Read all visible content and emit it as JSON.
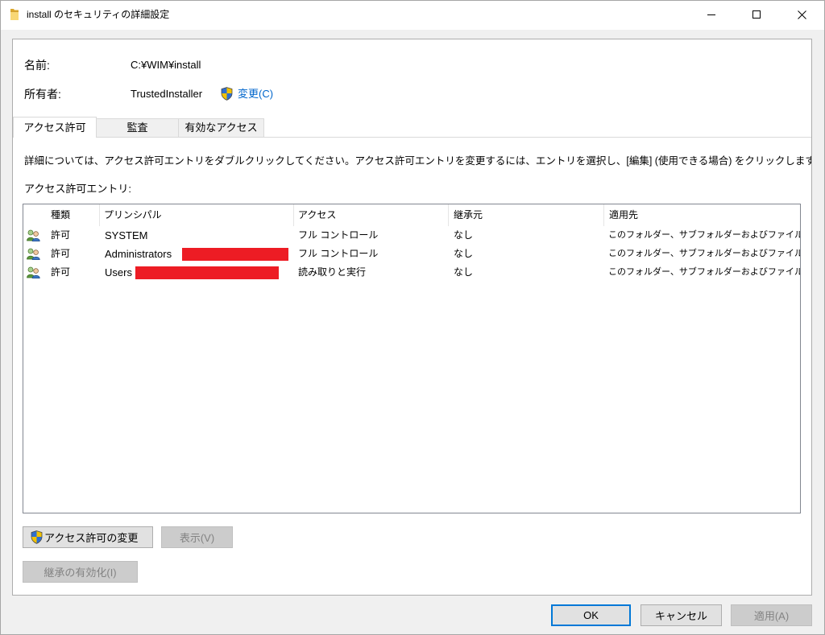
{
  "window": {
    "title": "install のセキュリティの詳細設定",
    "icon": "folder-icon",
    "controls": [
      "minimize-icon",
      "maximize-icon",
      "close-icon"
    ]
  },
  "colors": {
    "link": "#0066cc",
    "redaction": "#ed1c24",
    "default_button_border": "#0078d7"
  },
  "object": {
    "name_label": "名前:",
    "name_value": "C:¥WIM¥install",
    "owner_label": "所有者:",
    "owner_value": "TrustedInstaller",
    "owner_change_icon": "uac-shield-icon",
    "owner_change_link": "変更(C)"
  },
  "tabs": [
    {
      "label": "アクセス許可",
      "selected": true
    },
    {
      "label": "監査",
      "selected": false
    },
    {
      "label": "有効なアクセス",
      "selected": false
    }
  ],
  "permissions": {
    "description": "詳細については、アクセス許可エントリをダブルクリックしてください。アクセス許可エントリを変更するには、エントリを選択し、[編集] (使用できる場合) をクリックします。",
    "entries_label": "アクセス許可エントリ:",
    "columns": [
      "種類",
      "プリンシパル",
      "アクセス",
      "継承元",
      "適用先"
    ],
    "rows": [
      {
        "icon": "users-icon",
        "type": "許可",
        "principal": "SYSTEM",
        "access": "フル コントロール",
        "inherited_from": "なし",
        "applies_to": "このフォルダー、サブフォルダーおよびファイル"
      },
      {
        "icon": "users-icon",
        "type": "許可",
        "principal": "Administrators",
        "access": "フル コントロール",
        "inherited_from": "なし",
        "applies_to": "このフォルダー、サブフォルダーおよびファイル"
      },
      {
        "icon": "users-icon",
        "type": "許可",
        "principal": "Users",
        "access": "読み取りと実行",
        "inherited_from": "なし",
        "applies_to": "このフォルダー、サブフォルダーおよびファイル"
      }
    ]
  },
  "buttons": {
    "change_permissions": {
      "label": "アクセス許可の変更",
      "icon": "uac-shield-icon",
      "disabled": false
    },
    "view": {
      "label": "表示(V)",
      "disabled": true
    },
    "enable_inheritance": {
      "label": "継承の有効化(I)",
      "disabled": true
    }
  },
  "footer": {
    "ok": {
      "label": "OK",
      "default": true,
      "disabled": false
    },
    "cancel": {
      "label": "キャンセル",
      "disabled": false
    },
    "apply": {
      "label": "適用(A)",
      "disabled": true
    }
  }
}
